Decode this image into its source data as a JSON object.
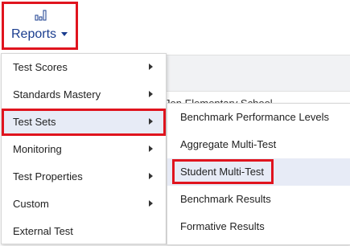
{
  "reports_button": {
    "label": "Reports",
    "icon": "bar-chart-icon"
  },
  "background": {
    "school_name": "Jon Elementary School"
  },
  "main_menu": {
    "items": [
      {
        "label": "Test Scores",
        "has_submenu": true
      },
      {
        "label": "Standards Mastery",
        "has_submenu": true
      },
      {
        "label": "Test Sets",
        "has_submenu": true,
        "active": true
      },
      {
        "label": "Monitoring",
        "has_submenu": true
      },
      {
        "label": "Test Properties",
        "has_submenu": true
      },
      {
        "label": "Custom",
        "has_submenu": true
      },
      {
        "label": "External Test",
        "has_submenu": false
      }
    ]
  },
  "sub_menu": {
    "items": [
      {
        "label": "Benchmark Performance Levels"
      },
      {
        "label": "Aggregate Multi-Test"
      },
      {
        "label": "Student Multi-Test",
        "active": true
      },
      {
        "label": "Benchmark Results"
      },
      {
        "label": "Formative Results"
      }
    ]
  },
  "colors": {
    "highlight": "#e0141e",
    "brand_text": "#1a3d8f",
    "active_bg": "#e7ebf6"
  }
}
